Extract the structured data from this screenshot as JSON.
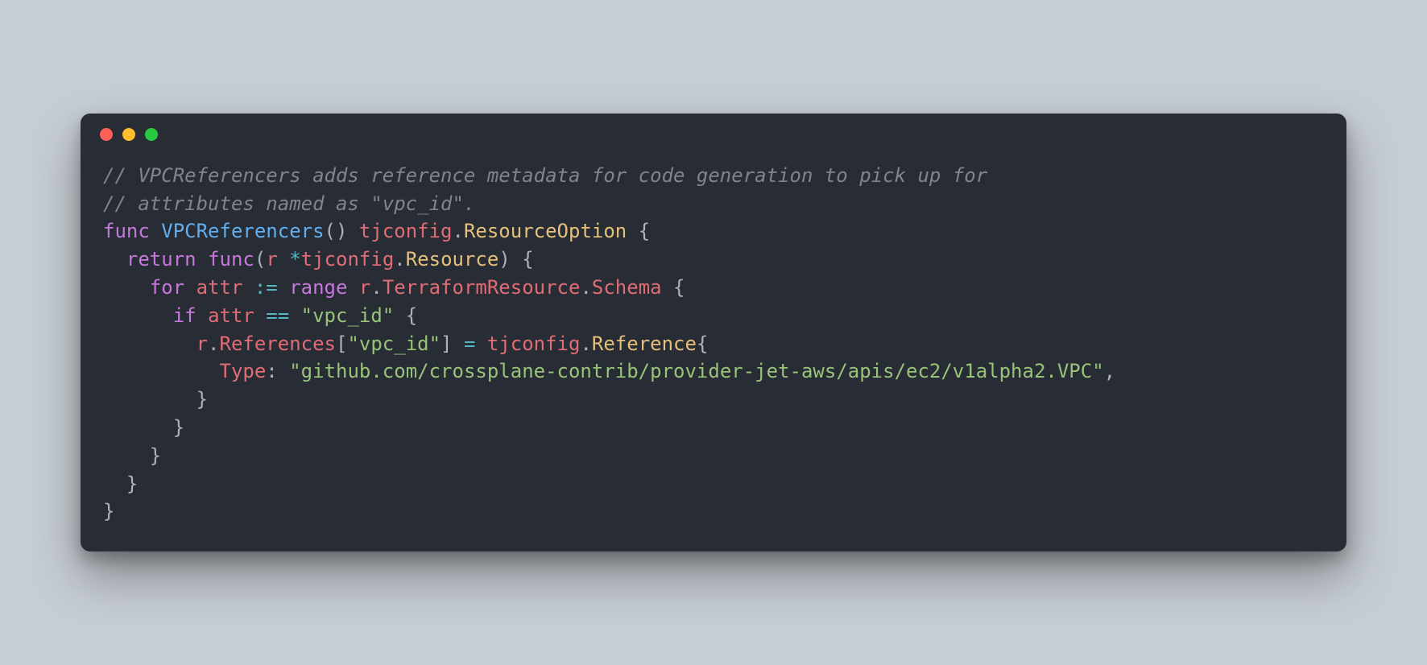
{
  "colors": {
    "page_bg": "#c6cdd3",
    "window_bg": "#282c34",
    "dot_red": "#ff5f56",
    "dot_yellow": "#ffbd2e",
    "dot_green": "#27c93f",
    "comment": "#7f848e",
    "keyword": "#c678dd",
    "func": "#61afef",
    "type": "#e5c07b",
    "ident": "#e06c75",
    "op": "#56b6c2",
    "punct": "#abb2bf",
    "string": "#98c379"
  },
  "code": {
    "comment1": "// VPCReferencers adds reference metadata for code generation to pick up for",
    "comment2": "// attributes named as \"vpc_id\".",
    "kw_func": "func",
    "fn_name": "VPCReferencers",
    "paren_empty": "()",
    "ret_pkg": "tjconfig",
    "dot1": ".",
    "ret_type": "ResourceOption",
    "brace_open": " {",
    "indent1": "  ",
    "kw_return": "return",
    "sp": " ",
    "kw_func2": "func",
    "paren_open": "(",
    "param_r": "r",
    "star": "*",
    "param_pkg": "tjconfig",
    "dot2": ".",
    "param_type": "Resource",
    "paren_close_brace": ") {",
    "indent2": "    ",
    "kw_for": "for",
    "var_attr": "attr",
    "walrus": " := ",
    "kw_range": "range",
    "r2": "r",
    "dot3": ".",
    "tf_res": "TerraformResource",
    "dot4": ".",
    "schema": "Schema",
    "brace_open2": " {",
    "indent3": "      ",
    "kw_if": "if",
    "var_attr2": "attr",
    "eqeq": " == ",
    "str_vpc1": "\"vpc_id\"",
    "brace_open3": " {",
    "indent4": "        ",
    "r3": "r",
    "dot5": ".",
    "refs": "References",
    "lbrack": "[",
    "str_vpc2": "\"vpc_id\"",
    "rbrack": "]",
    "assign": " = ",
    "ref_pkg": "tjconfig",
    "dot6": ".",
    "ref_type": "Reference",
    "brace_open4": "{",
    "indent5": "          ",
    "field_type": "Type",
    "colon_sp": ": ",
    "str_path": "\"github.com/crossplane-contrib/provider-jet-aws/apis/ec2/v1alpha2.VPC\"",
    "comma": ",",
    "indent4b": "        ",
    "brace_close4": "}",
    "indent3b": "      ",
    "brace_close3": "}",
    "indent2b": "    ",
    "brace_close2": "}",
    "indent1b": "  ",
    "brace_close1": "}",
    "brace_close0": "}"
  }
}
